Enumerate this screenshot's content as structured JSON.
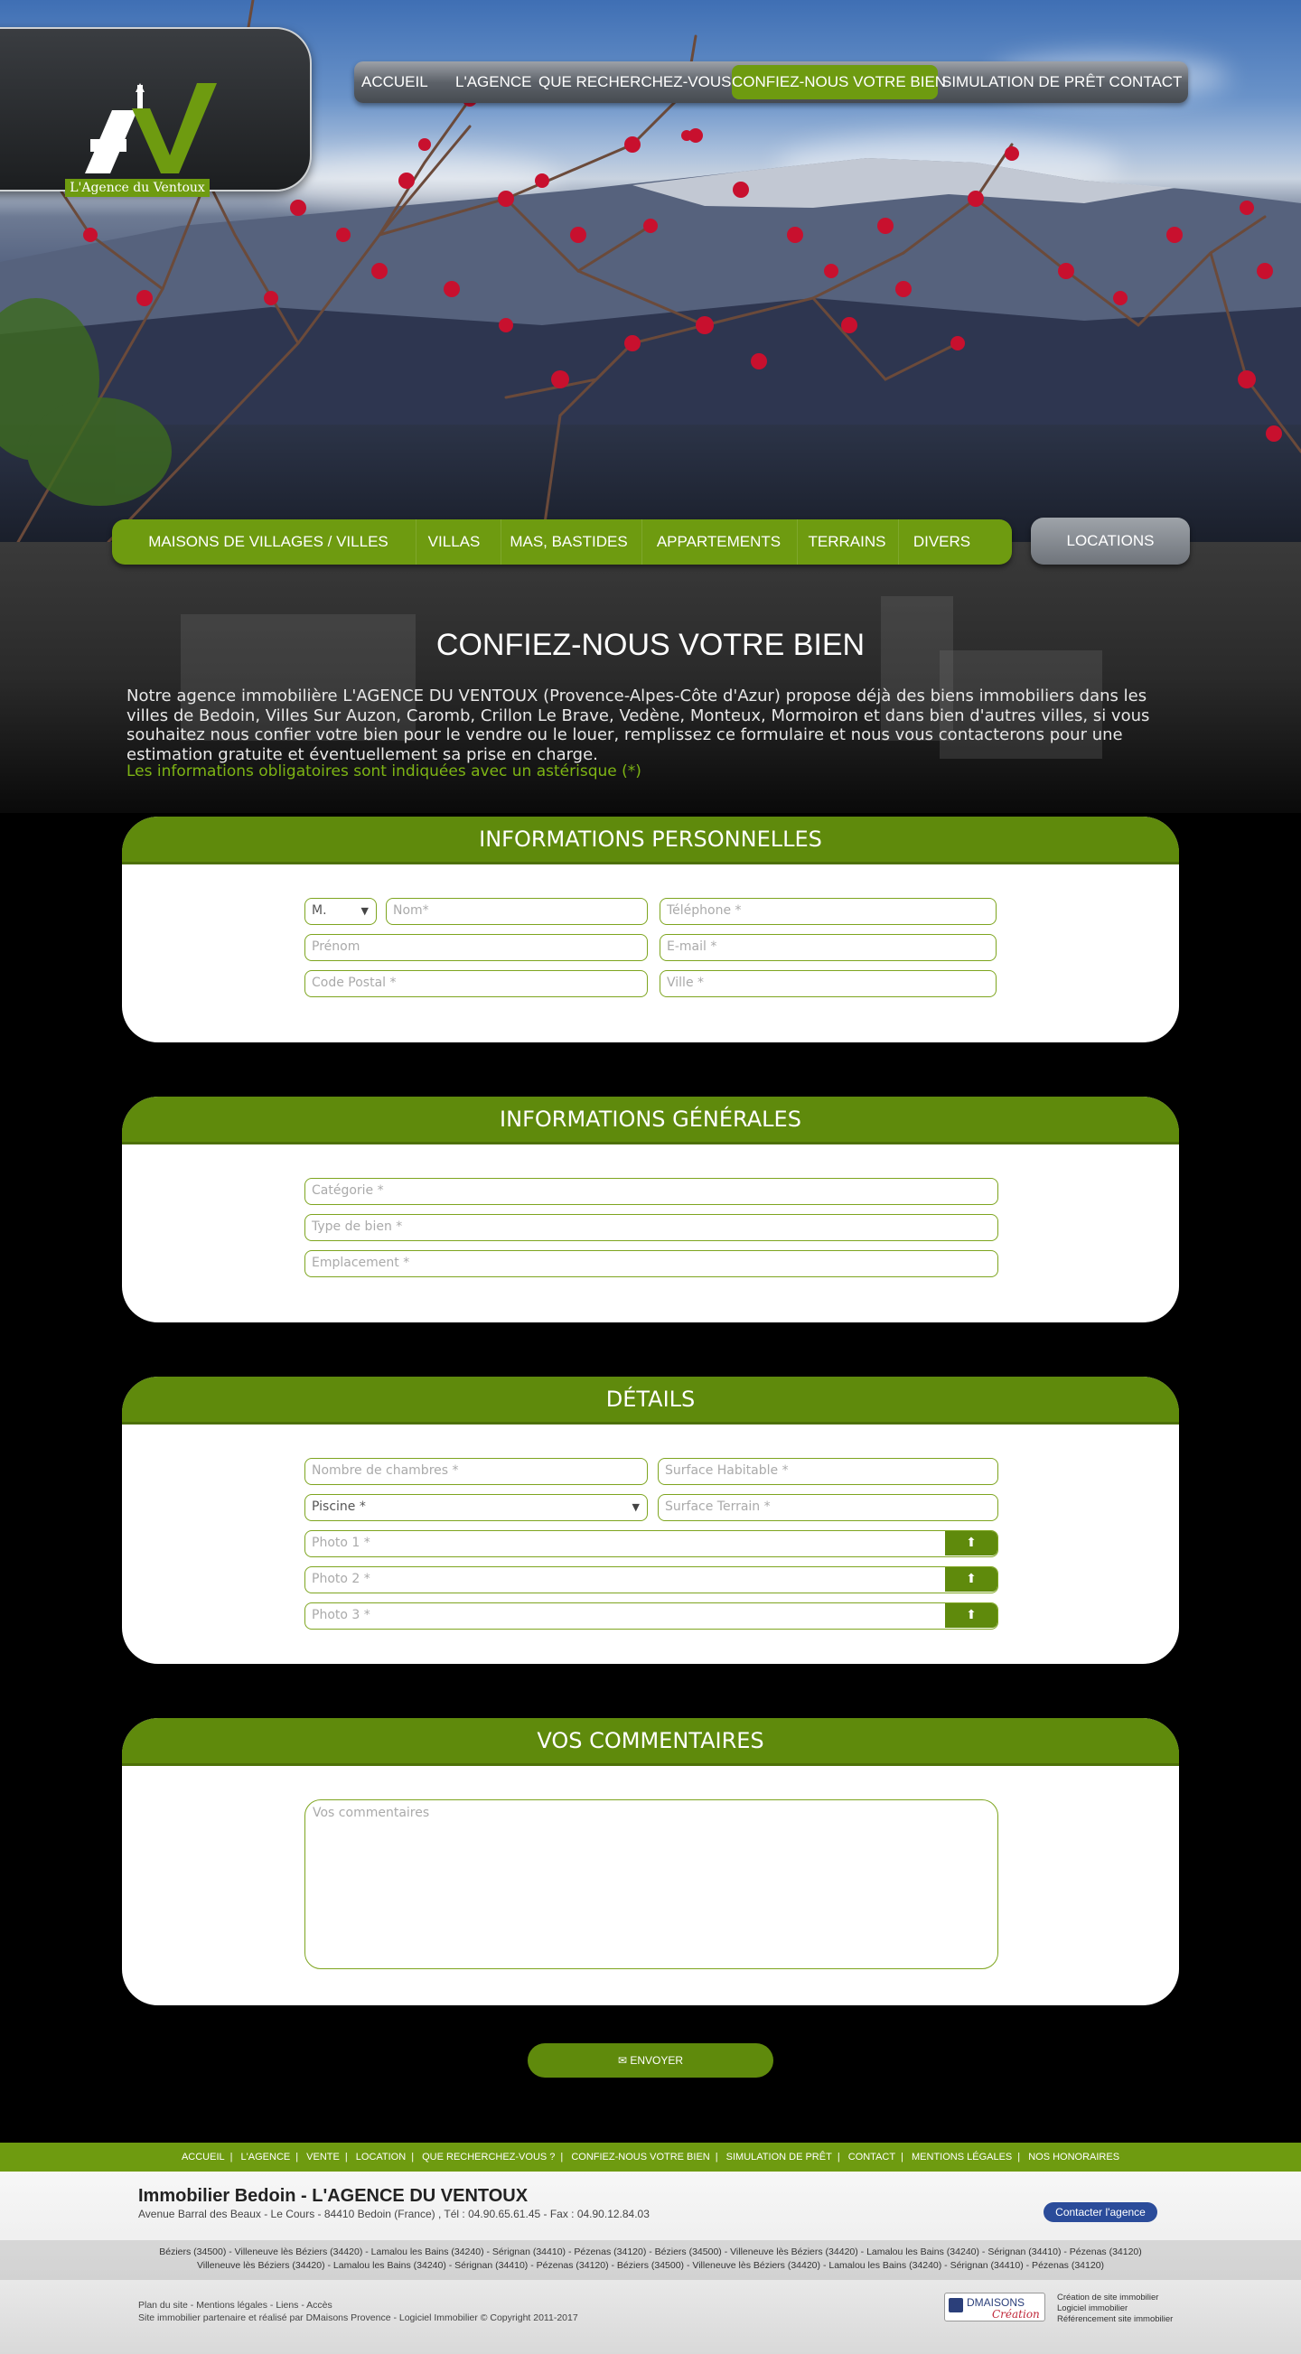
{
  "logo": {
    "text": "L'Agence du Ventoux"
  },
  "main_nav": [
    {
      "label": "ACCUEIL",
      "active": false
    },
    {
      "label": "L'AGENCE",
      "active": false
    },
    {
      "label": "QUE RECHERCHEZ-VOUS ?",
      "active": false
    },
    {
      "label": "CONFIEZ-NOUS VOTRE BIEN",
      "active": true
    },
    {
      "label": "SIMULATION DE PRÊT",
      "active": false
    },
    {
      "label": "CONTACT",
      "active": false
    }
  ],
  "categories": [
    "MAISONS DE VILLAGES / VILLES",
    "VILLAS",
    "MAS, BASTIDES",
    "APPARTEMENTS",
    "TERRAINS",
    "DIVERS"
  ],
  "locations_label": "LOCATIONS",
  "page": {
    "title": "CONFIEZ-NOUS VOTRE BIEN",
    "intro": "Notre agence immobilière L'AGENCE DU VENTOUX (Provence-Alpes-Côte d'Azur) propose déjà des biens immobiliers dans les villes de Bedoin, Villes Sur Auzon, Caromb, Crillon Le Brave, Vedène, Monteux, Mormoiron et dans bien d'autres villes, si vous souhaitez nous confier votre bien pour le vendre ou le louer, remplissez ce formulaire et nous vous contacterons pour une estimation gratuite et éventuellement sa prise en charge.",
    "mandatory_note": "Les informations obligatoires sont indiquées avec un astérisque (*)"
  },
  "personal": {
    "title": "INFORMATIONS PERSONNELLES",
    "civility": "M.",
    "nom": "Nom*",
    "telephone": "Téléphone *",
    "prenom": "Prénom",
    "email": "E-mail *",
    "code_postal": "Code Postal *",
    "ville": "Ville *"
  },
  "general": {
    "title": "INFORMATIONS GÉNÉRALES",
    "categorie": "Catégorie *",
    "type_bien": "Type de bien *",
    "emplacement": "Emplacement *"
  },
  "details": {
    "title": "DÉTAILS",
    "chambres": "Nombre de chambres *",
    "surface_habitable": "Surface Habitable *",
    "piscine": "Piscine *",
    "surface_terrain": "Surface Terrain *",
    "photo1": "Photo 1 *",
    "photo2": "Photo 2 *",
    "photo3": "Photo 3 *"
  },
  "comments": {
    "title": "VOS COMMENTAIRES",
    "placeholder": "Vos commentaires"
  },
  "submit_label": "ENVOYER",
  "footer_nav": [
    "ACCUEIL",
    "L'AGENCE",
    "VENTE",
    "LOCATION",
    "QUE RECHERCHEZ-VOUS ?",
    "CONFIEZ-NOUS VOTRE BIEN",
    "SIMULATION DE PRÊT",
    "CONTACT",
    "MENTIONS LÉGALES",
    "NOS HONORAIRES"
  ],
  "footer": {
    "title": "Immobilier Bedoin - L'AGENCE DU VENTOUX",
    "address": "Avenue Barral des Beaux - Le Cours - 84410 Bedoin (France) , Tél : 04.90.65.61.45 - Fax : 04.90.12.84.03",
    "contact_button": "Contacter l'agence",
    "cities_line1": "Béziers (34500) - Villeneuve lès Béziers (34420) - Lamalou les Bains (34240) - Sérignan (34410) - Pézenas (34120) - Béziers (34500) - Villeneuve lès Béziers (34420) - Lamalou les Bains (34240) - Sérignan (34410) - Pézenas (34120)",
    "cities_line2": "Villeneuve lès Béziers (34420) - Lamalou les Bains (34240) - Sérignan (34410) - Pézenas (34120) - Béziers (34500) - Villeneuve lès Béziers (34420) - Lamalou les Bains (34240) - Sérignan (34410) - Pézenas (34120)",
    "links_line1": "Plan du site - Mentions légales - Liens - Accès",
    "links_line2": "Site immobilier partenaire et réalisé par DMaisons Provence - Logiciel Immobilier © Copyright 2011-2017",
    "dmaisons_name": "DMAISONS",
    "dmaisons_sub": "Création",
    "dmaisons_tag1": "Création de site immobilier",
    "dmaisons_tag2": "Logiciel immobilier",
    "dmaisons_tag3": "Référencement site immobilier"
  },
  "colors": {
    "brand_green": "#6e9b10",
    "panel_header_green": "#5f8a0c",
    "note_green": "#7db414",
    "contact_blue": "#2b4c9a"
  }
}
